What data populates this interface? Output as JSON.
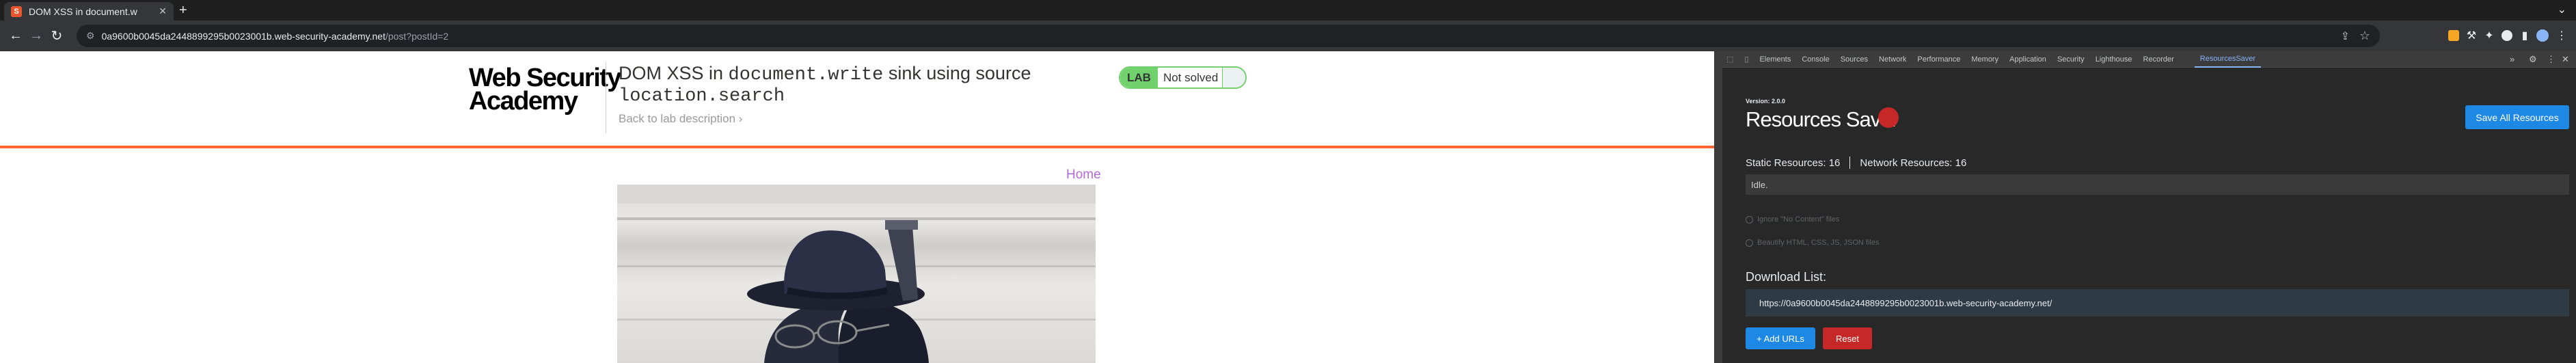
{
  "tab": {
    "favicon_letter": "S",
    "title": "DOM XSS in document.w",
    "close": "✕"
  },
  "browser": {
    "new_tab": "+",
    "tab_search": "⌄",
    "back": "←",
    "forward": "→",
    "reload": "↻",
    "url_host": "0a9600b0045da2448899295b0023001b.web-security-academy.net",
    "url_path": "/post?postId=2",
    "share": "⇪",
    "bookmark": "☆",
    "menu": "⋮"
  },
  "lab": {
    "logo_line1": "Web Security",
    "logo_line2": "Academy",
    "title_text_1": "DOM XSS in ",
    "title_code_1": "document.write",
    "title_text_2": " sink using source ",
    "title_code_2": "location.search",
    "back_link": "Back to lab description  ›",
    "badge_label": "LAB",
    "badge_status": "Not solved",
    "home_link": "Home"
  },
  "devtools": {
    "tabs": [
      "Elements",
      "Console",
      "Sources",
      "Network",
      "Performance",
      "Memory",
      "Application",
      "Security",
      "Lighthouse",
      "Recorder",
      "ResourcesSaver"
    ],
    "active_tab": "ResourcesSaver",
    "more_tabs": "»",
    "settings": "⚙",
    "menu": "⋮",
    "close": "✕"
  },
  "resources_saver": {
    "version": "Version: 2.0.0",
    "title": "Resources Saver",
    "save_all": "Save All Resources",
    "static_label": "Static Resources: 16",
    "network_label": "Network Resources: 16",
    "status_text": "Idle.",
    "option_1": "Ignore \"No Content\" files",
    "option_2": "Beautify HTML, CSS, JS, JSON files",
    "download_list_label": "Download List:",
    "download_url": "https://0a9600b0045da2448899295b0023001b.web-security-academy.net/",
    "add_urls": "+ Add URLs",
    "reset": "Reset"
  },
  "colors": {
    "accent_orange": "#ff6633",
    "lab_green": "#70d16d",
    "link_purple": "#b467d9",
    "save_blue": "#1e88e5",
    "reset_red": "#c62828"
  }
}
